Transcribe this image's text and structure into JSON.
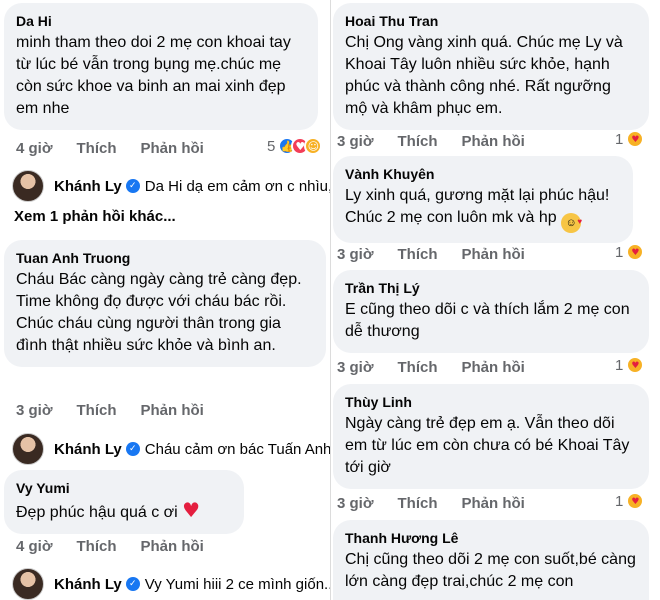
{
  "actions": {
    "time": "4 giờ",
    "time3": "3 giờ",
    "like": "Thích",
    "reply": "Phản hồi"
  },
  "left": {
    "c1": {
      "name": "Da Hi",
      "text": "minh tham theo doi 2 mẹ con khoai tay từ lúc bé vẫn trong bụng mẹ.chúc mẹ còn sức khoe va binh an mai xinh đẹp em nhe",
      "reactions": "5"
    },
    "r1": {
      "name": "Khánh Ly",
      "text": "Da Hi dạ em cảm ơn c nhìu,..."
    },
    "more": "Xem 1 phản hồi khác...",
    "c2": {
      "name": "Tuan Anh Truong",
      "text": "Cháu Bác càng ngày càng trẻ càng đẹp. Time không đọ được với cháu bác rồi. Chúc cháu cùng người thân trong gia đình thật nhiều sức khỏe và bình an."
    },
    "r2": {
      "name": "Khánh Ly",
      "text": "Cháu cảm ơn bác Tuấn Anh..."
    },
    "c3": {
      "name": "Vy Yumi",
      "text": "Đẹp phúc hậu quá c ơi"
    },
    "r3": {
      "name": "Khánh Ly",
      "text": "Vy Yumi hiii 2 ce mình giốn..."
    }
  },
  "right": {
    "c1": {
      "name": "Hoai Thu Tran",
      "text": "Chị Ong vàng xinh quá. Chúc mẹ Ly và Khoai Tây luôn nhiều sức khỏe, hạnh phúc và thành công nhé. Rất ngưỡng mộ và khâm phục em.",
      "reactions": "1"
    },
    "c2": {
      "name": "Vành Khuyên",
      "text": "Ly xinh quá, gương mặt lại phúc hậu! Chúc 2 mẹ con luôn mk và hp",
      "reactions": "1"
    },
    "c3": {
      "name": "Trần Thị Lý",
      "text": "E cũng theo dõi c và thích lắm 2 mẹ con dễ thương",
      "reactions": "1"
    },
    "c4": {
      "name": "Thùy Linh",
      "text": "Ngày càng trẻ đẹp em ạ. Vẫn theo dõi em từ lúc em còn chưa có bé Khoai Tây tới giờ",
      "reactions": "1"
    },
    "c5": {
      "name": "Thanh Hương Lê",
      "text": "Chị cũng theo dõi 2 mẹ con suốt,bé càng lớn càng đẹp trai,chúc 2 mẹ con"
    }
  },
  "icons": {
    "like": "like-reaction-icon",
    "love": "love-reaction-icon",
    "care": "care-reaction-icon",
    "verified": "verified-check-icon",
    "heart": "red-heart-emoji",
    "smiling_hearts": "smiling-face-with-hearts-emoji"
  },
  "colors": {
    "bubble": "#f0f2f5",
    "meta": "#65676b",
    "accent": "#1877f2",
    "heart": "#e41e3f"
  }
}
